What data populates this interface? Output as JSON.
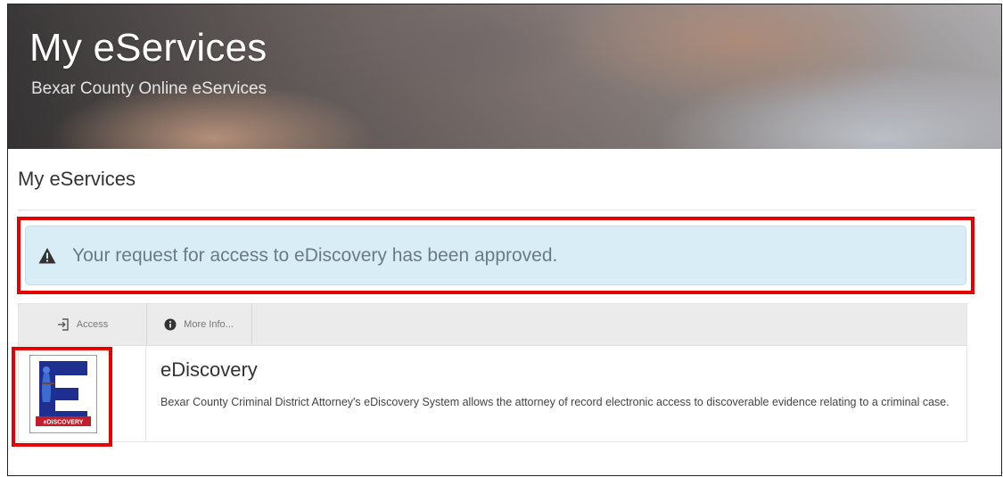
{
  "banner": {
    "title": "My eServices",
    "subtitle": "Bexar County Online eServices"
  },
  "page": {
    "heading": "My eServices"
  },
  "alert": {
    "icon": "warning-triangle-icon",
    "message": "Your request for access to eDiscovery has been approved.",
    "background": "#d9edf7"
  },
  "service": {
    "toolbar": {
      "access_label": "Access",
      "access_icon": "sign-in-icon",
      "more_info_label": "More Info...",
      "more_info_icon": "info-circle-icon"
    },
    "logo": {
      "icon": "ediscovery-logo-icon",
      "banner_text": "eDISCOVERY"
    },
    "name": "eDiscovery",
    "description": "Bexar County Criminal District Attorney's eDiscovery System allows the attorney of record electronic access to discoverable evidence relating to a criminal case."
  },
  "colors": {
    "highlight": "#e60000",
    "toolbar": "#ebebeb"
  }
}
